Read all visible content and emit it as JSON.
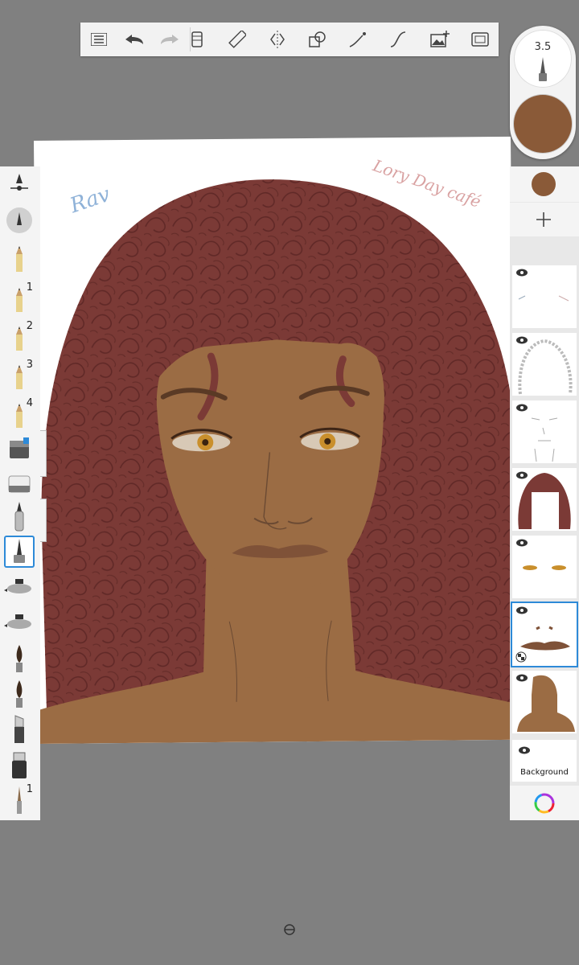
{
  "toolbar": {
    "items": [
      "menu",
      "undo",
      "redo",
      "layer-stack",
      "ruler",
      "symmetry",
      "shapes",
      "stroke-path",
      "curve",
      "add-image",
      "fullscreen"
    ]
  },
  "brush_puck": {
    "size_value": "3.5",
    "color_hex": "#8a5a38"
  },
  "brushes": [
    {
      "name": "brush-size-slider",
      "number": ""
    },
    {
      "name": "round-brush",
      "number": ""
    },
    {
      "name": "pencil",
      "number": ""
    },
    {
      "name": "pencil",
      "number": "1"
    },
    {
      "name": "pencil",
      "number": "2"
    },
    {
      "name": "pencil",
      "number": "3"
    },
    {
      "name": "pencil",
      "number": "4"
    },
    {
      "name": "eraser-hard",
      "number": ""
    },
    {
      "name": "eraser-soft",
      "number": ""
    },
    {
      "name": "technical-pen",
      "number": ""
    },
    {
      "name": "ballpoint-pen",
      "number": ""
    },
    {
      "name": "airbrush",
      "number": ""
    },
    {
      "name": "airbrush",
      "number": ""
    },
    {
      "name": "paintbrush",
      "number": ""
    },
    {
      "name": "paintbrush",
      "number": ""
    },
    {
      "name": "chisel-marker",
      "number": ""
    },
    {
      "name": "marker",
      "number": ""
    },
    {
      "name": "fine-brush",
      "number": "1"
    }
  ],
  "layers": {
    "current_color_hex": "#8a5a38",
    "background_label": "Background"
  },
  "signatures": {
    "left": "Rav",
    "right": "Lory Day café"
  },
  "colors": {
    "hair": "#7b3a36",
    "skin": "#9b6c44",
    "iris": "#c98f2c",
    "accent": "#2d8ad8"
  }
}
